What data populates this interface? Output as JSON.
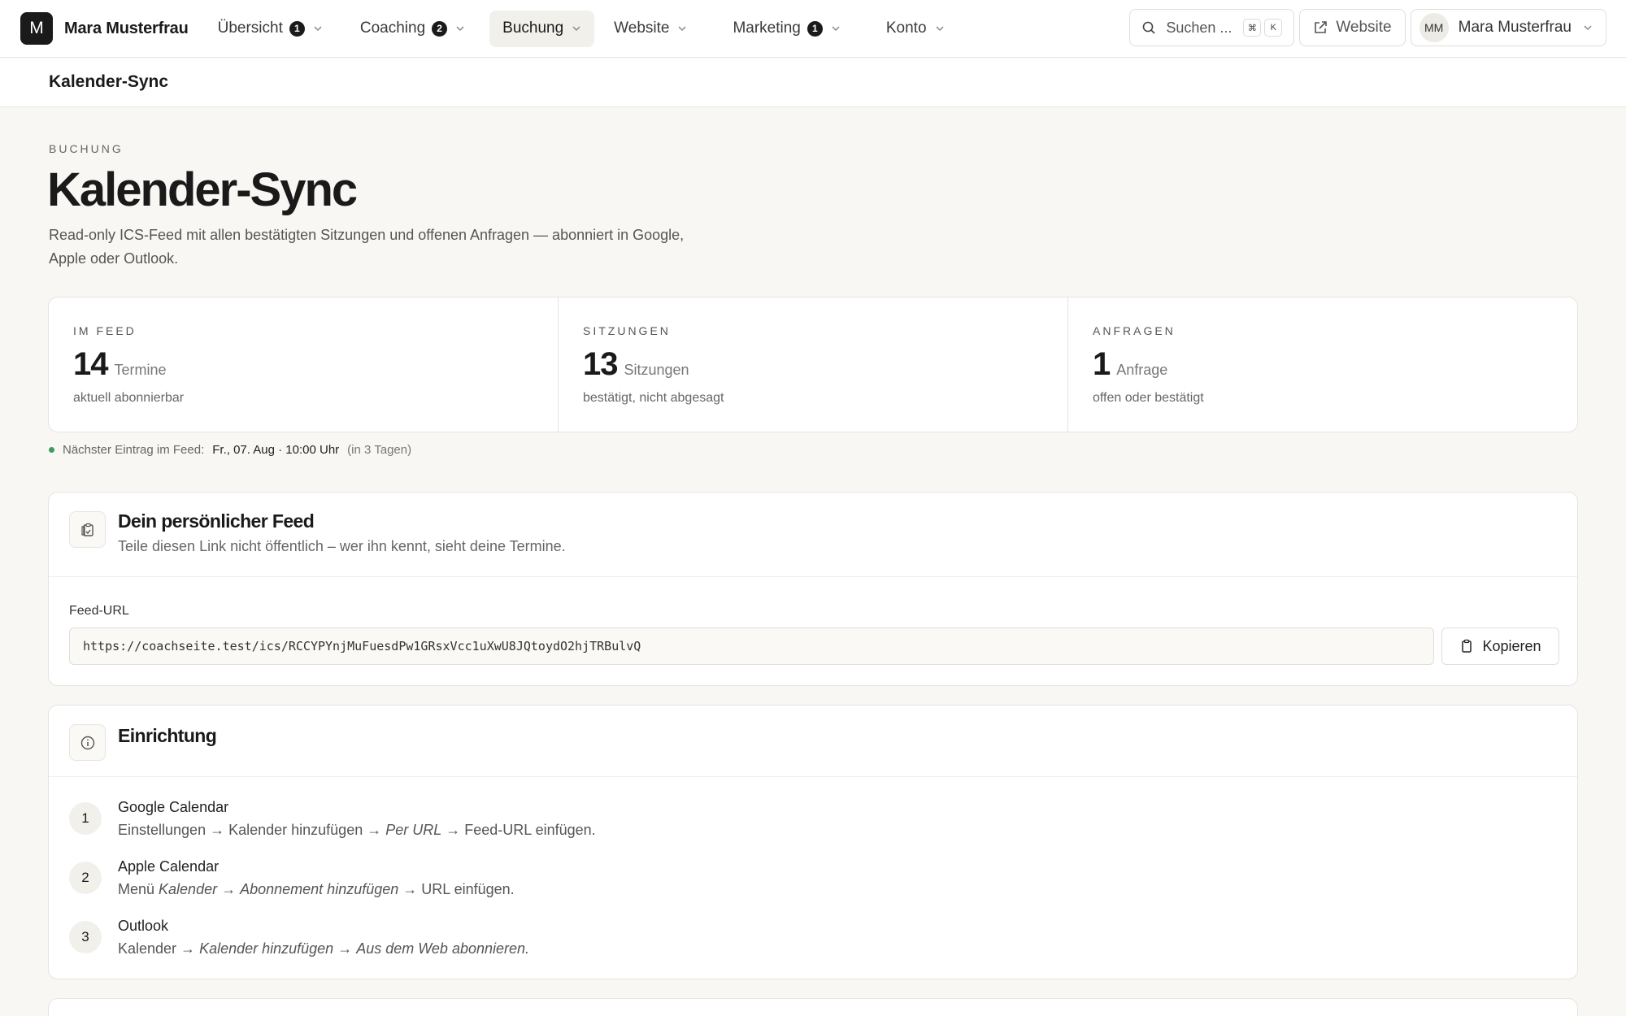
{
  "brand": {
    "logo_letter": "M",
    "name": "Mara Musterfrau"
  },
  "nav": {
    "items": [
      {
        "label": "Übersicht",
        "badge": "1"
      },
      {
        "label": "Coaching",
        "badge": "2"
      },
      {
        "label": "Buchung",
        "badge": ""
      },
      {
        "label": "Website",
        "badge": ""
      },
      {
        "label": "Marketing",
        "badge": "1"
      },
      {
        "label": "Konto",
        "badge": ""
      }
    ],
    "active": "Buchung"
  },
  "search": {
    "label": "Suchen ...",
    "kbd1": "⌘",
    "kbd2": "K"
  },
  "website_button": "Website",
  "user": {
    "initials": "MM",
    "name": "Mara Musterfrau"
  },
  "subheader": {
    "title": "Kalender-Sync"
  },
  "header": {
    "eyebrow": "BUCHUNG",
    "title": "Kalender-Sync",
    "description": "Read-only ICS-Feed mit allen bestätigten Sitzungen und offenen Anfragen — abonniert in Google, Apple oder Outlook."
  },
  "stats": [
    {
      "label": "IM FEED",
      "value": "14",
      "unit": "Termine",
      "sub": "aktuell abonnierbar"
    },
    {
      "label": "SITZUNGEN",
      "value": "13",
      "unit": "Sitzungen",
      "sub": "bestätigt, nicht abgesagt"
    },
    {
      "label": "ANFRAGEN",
      "value": "1",
      "unit": "Anfrage",
      "sub": "offen oder bestätigt"
    }
  ],
  "next_entry": {
    "label": "Nächster Eintrag im Feed:",
    "date": "Fr., 07. Aug · 10:00 Uhr",
    "relative": "(in 3 Tagen)",
    "status_color": "#3f9b5e"
  },
  "feed_card": {
    "title": "Dein persönlicher Feed",
    "subtitle": "Teile diesen Link nicht öffentlich – wer ihn kennt, sieht deine Termine.",
    "field_label": "Feed-URL",
    "url": "https://coachseite.test/ics/RCCYPYnjMuFuesdPw1GRsxVcc1uXwU8JQtoydO2hjTRBulvQ",
    "copy_label": "Kopieren"
  },
  "setup_card": {
    "title": "Einrichtung",
    "steps": [
      {
        "num": "1",
        "title": "Google Calendar",
        "d1": "Einstellungen → Kalender hinzufügen → ",
        "d2": "Per URL",
        "d3": " → Feed-URL einfügen.",
        "d4": "",
        "d5": ""
      },
      {
        "num": "2",
        "title": "Apple Calendar",
        "d1": "Menü ",
        "d2": "Kalender",
        "d3": " → ",
        "d4": "Abonnement hinzufügen",
        "d5": " → URL einfügen."
      },
      {
        "num": "3",
        "title": "Outlook",
        "d1": "Kalender → ",
        "d2": "Kalender hinzufügen",
        "d3": " → ",
        "d4": "Aus dem Web abonnieren.",
        "d5": ""
      }
    ]
  }
}
